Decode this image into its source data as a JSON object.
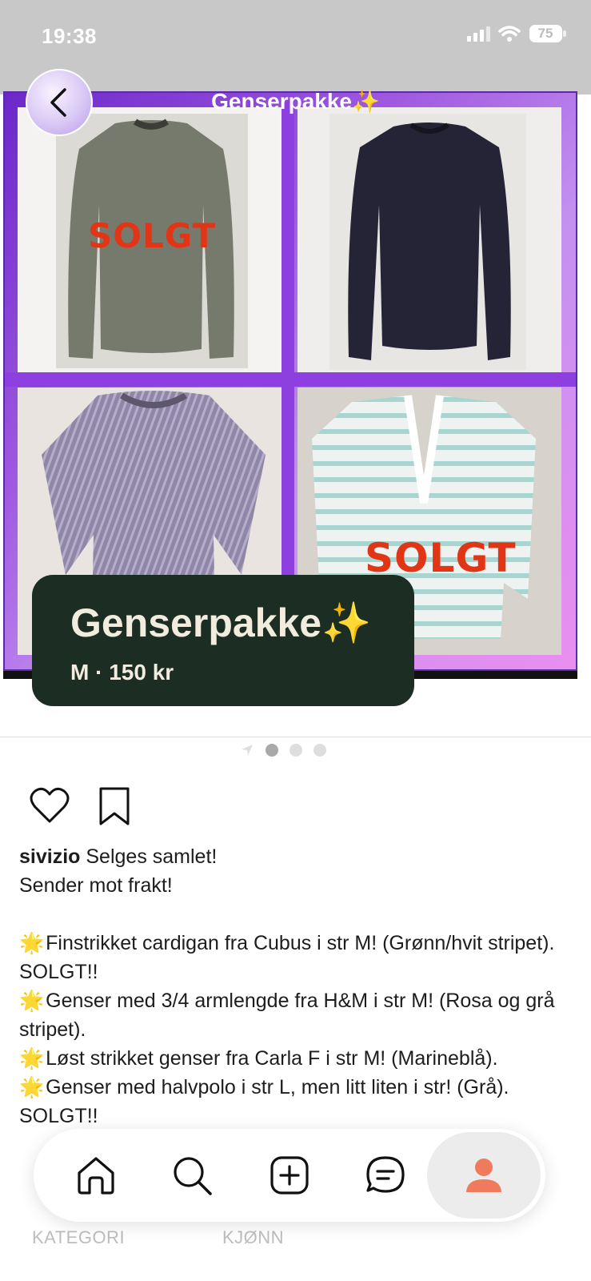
{
  "status_bar": {
    "time": "19:38",
    "battery": "75"
  },
  "listing": {
    "collage_title": "Genserpakke✨",
    "sold_labels": [
      "SOLGT",
      "SOLGT"
    ],
    "title": "Genserpakke✨",
    "size": "M",
    "separator": "·",
    "price": "150 kr"
  },
  "pager": {
    "count": 3,
    "active_index": 0
  },
  "description": {
    "username": "sivizio",
    "first_line": "Selges samlet!",
    "line2": "Sender mot frakt!",
    "items": [
      "Finstrikket cardigan fra Cubus i str M! (Grønn/hvit stripet). SOLGT!!",
      "Genser med 3/4 armlengde fra H&M i str M! (Rosa og grå stripet).",
      "Løst strikket genser fra Carla F i str M! (Marineblå).",
      "Genser med halvpolo i str L, men litt liten i str! (Grå). SOLGT!!"
    ],
    "star_glyph": "🌟"
  },
  "info_labels": {
    "category": "KATEGORI",
    "gender": "KJØNN"
  },
  "nav": {
    "items": [
      "home-icon",
      "search-icon",
      "add-icon",
      "chat-icon",
      "profile-icon"
    ],
    "accent": "#f07a5c"
  },
  "colors": {
    "card_bg": "#1c2e24",
    "card_text": "#f2ecdf",
    "sold_red": "#e23515",
    "collage_purple": "#8e3fe0"
  }
}
